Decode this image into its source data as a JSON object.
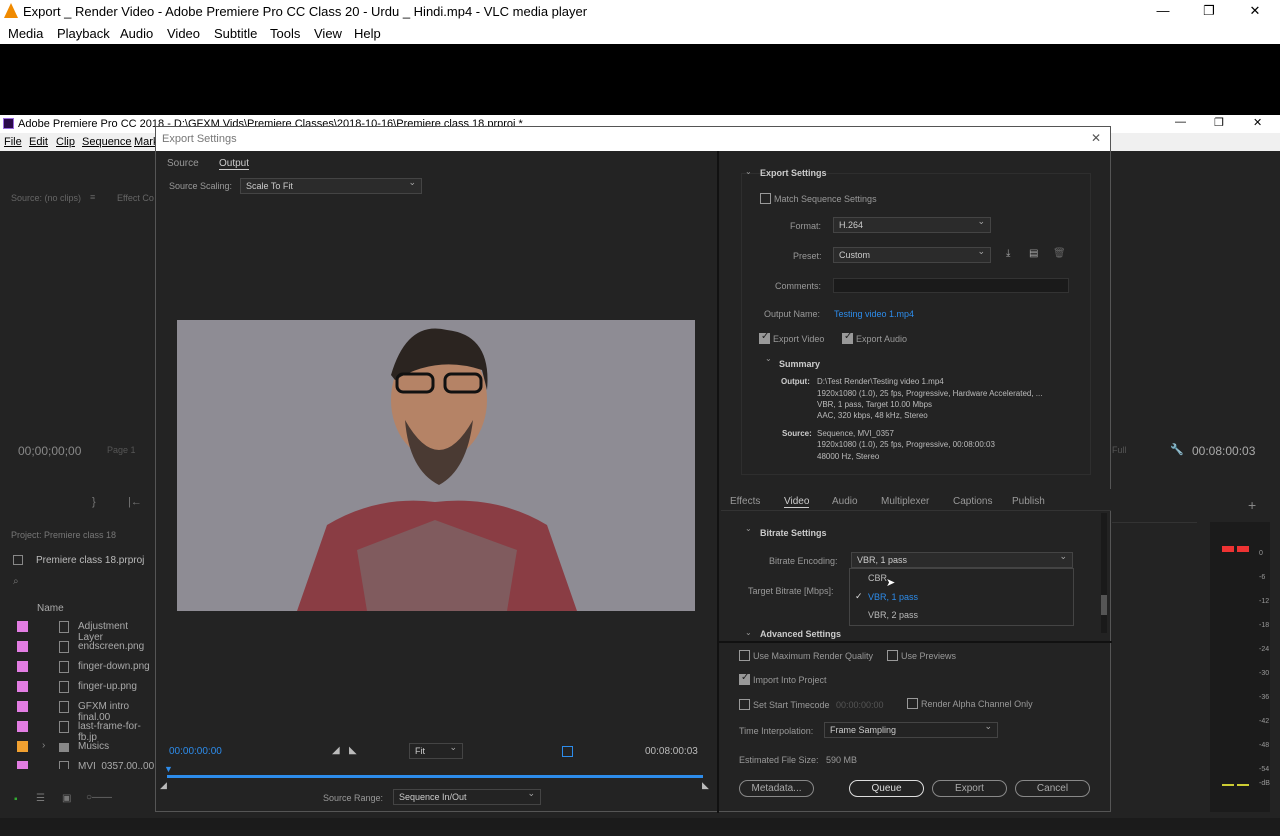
{
  "vlc": {
    "title": "Export _ Render Video - Adobe Premiere Pro CC Class 20 - Urdu _ Hindi.mp4 - VLC media player",
    "menu": [
      "Media",
      "Playback",
      "Audio",
      "Video",
      "Subtitle",
      "Tools",
      "View",
      "Help"
    ]
  },
  "premiere": {
    "title": "Adobe Premiere Pro CC 2018 - D:\\GFXM Vids\\Premiere Classes\\2018-10-16\\Premiere class 18.prproj *",
    "menu": [
      "File",
      "Edit",
      "Clip",
      "Sequence",
      "Mark"
    ],
    "source_panel": "Source: (no clips)",
    "effect_controls": "Effect Co",
    "timecode_left": "00;00;00;00",
    "page_label": "Page 1",
    "timecode_right": "00:08:00:03",
    "full_label": "Full",
    "project_tab": "Project: Premiere class 18",
    "project_file": "Premiere class 18.prproj",
    "name_col": "Name",
    "files": [
      "Adjustment Layer",
      "endscreen.png",
      "finger-down.png",
      "finger-up.png",
      "GFXM intro final.00",
      "last-frame-for-fb.jp",
      "Musics",
      "MVI_0357.00..00"
    ],
    "meter_labels": [
      "0",
      "-6",
      "-12",
      "-18",
      "-24",
      "-30",
      "-36",
      "-42",
      "-48",
      "-54",
      "-dB"
    ]
  },
  "dialog": {
    "title": "Export Settings",
    "tabs": [
      "Source",
      "Output"
    ],
    "source_scaling_label": "Source Scaling:",
    "source_scaling_value": "Scale To Fit",
    "timecode_start": "00:00:00:00",
    "timecode_end": "00:08:00:03",
    "fit": "Fit",
    "source_range_label": "Source Range:",
    "source_range_value": "Sequence In/Out",
    "export_settings": {
      "header": "Export Settings",
      "match_sequence": "Match Sequence Settings",
      "format_label": "Format:",
      "format_value": "H.264",
      "preset_label": "Preset:",
      "preset_value": "Custom",
      "comments_label": "Comments:",
      "output_name_label": "Output Name:",
      "output_name_value": "Testing video 1.mp4",
      "export_video": "Export Video",
      "export_audio": "Export Audio"
    },
    "summary": {
      "header": "Summary",
      "output_label": "Output:",
      "output_lines": [
        "D:\\Test Render\\Testing video 1.mp4",
        "1920x1080 (1.0), 25 fps, Progressive, Hardware Accelerated, ...",
        "VBR, 1 pass, Target 10.00 Mbps",
        "AAC, 320 kbps, 48 kHz, Stereo"
      ],
      "source_label": "Source:",
      "source_lines": [
        "Sequence, MVI_0357",
        "1920x1080 (1.0), 25 fps, Progressive, 00:08:00:03",
        "48000 Hz, Stereo"
      ]
    },
    "settings_tabs": [
      "Effects",
      "Video",
      "Audio",
      "Multiplexer",
      "Captions",
      "Publish"
    ],
    "bitrate": {
      "header": "Bitrate Settings",
      "encoding_label": "Bitrate Encoding:",
      "encoding_value": "VBR, 1 pass",
      "target_label": "Target Bitrate [Mbps]:",
      "options": [
        "CBR",
        "VBR, 1 pass",
        "VBR, 2 pass"
      ]
    },
    "advanced_header": "Advanced Settings",
    "bottom": {
      "max_render": "Use Maximum Render Quality",
      "use_previews": "Use Previews",
      "import_project": "Import Into Project",
      "set_start": "Set Start Timecode",
      "start_tc": "00:00:00:00",
      "render_alpha": "Render Alpha Channel Only",
      "interp_label": "Time Interpolation:",
      "interp_value": "Frame Sampling",
      "filesize_label": "Estimated File Size:",
      "filesize_value": "590 MB"
    },
    "buttons": {
      "metadata": "Metadata...",
      "queue": "Queue",
      "export": "Export",
      "cancel": "Cancel"
    }
  }
}
